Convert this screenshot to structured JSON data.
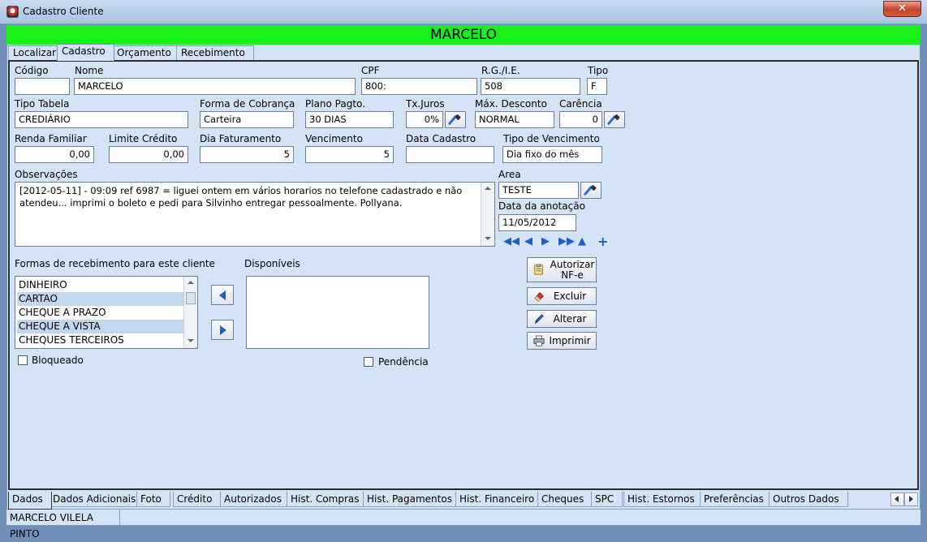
{
  "window": {
    "title": "Cadastro Cliente",
    "close_glyph": "✕"
  },
  "banner": {
    "name": "MARCELO"
  },
  "top_tabs": [
    {
      "label": "Localizar"
    },
    {
      "label": "Cadastro"
    },
    {
      "label": "Orçamento"
    },
    {
      "label": "Recebimento"
    }
  ],
  "form": {
    "codigo": {
      "label": "Código",
      "value": ""
    },
    "nome": {
      "label": "Nome",
      "value": "MARCELO"
    },
    "cpf": {
      "label": "CPF",
      "value": "800:"
    },
    "rg": {
      "label": "R.G./I.E.",
      "value": "508"
    },
    "tipo": {
      "label": "Tipo",
      "value": "F"
    },
    "tipo_tabela": {
      "label": "Tipo Tabela",
      "value": "CREDIÁRIO"
    },
    "forma_cobranca": {
      "label": "Forma de Cobrança",
      "value": "Carteira"
    },
    "plano_pagto": {
      "label": "Plano Pagto.",
      "value": "30 DIAS"
    },
    "tx_juros": {
      "label": "Tx.Juros",
      "value": "0%"
    },
    "max_desconto": {
      "label": "Máx. Desconto",
      "value": "NORMAL"
    },
    "carencia": {
      "label": "Carência",
      "value": "0"
    },
    "renda_familiar": {
      "label": "Renda Familiar",
      "value": "0,00"
    },
    "limite_credito": {
      "label": "Limite Crédito",
      "value": "0,00"
    },
    "dia_faturamento": {
      "label": "Dia Faturamento",
      "value": "5"
    },
    "vencimento": {
      "label": "Vencimento",
      "value": "5"
    },
    "data_cadastro": {
      "label": "Data Cadastro",
      "value": ""
    },
    "tipo_vencimento": {
      "label": "Tipo de Vencimento",
      "value": "Dia fixo do mês"
    },
    "observacoes": {
      "label": "Observações",
      "value": "[2012-05-11] - 09:09 ref 6987 = liguei ontem em vários horarios no telefone cadastrado e não atendeu... imprimi o boleto e pedi para Silvinho entregar pessoalmente. Pollyana."
    },
    "area": {
      "label": "Area",
      "value": "TESTE"
    },
    "data_anotacao": {
      "label": "Data da anotação",
      "value": "11/05/2012"
    }
  },
  "formas": {
    "label": "Formas de recebimento para este cliente",
    "items": [
      {
        "label": "DINHEIRO",
        "selected": false
      },
      {
        "label": "CARTAO",
        "selected": true
      },
      {
        "label": "CHEQUE A PRAZO",
        "selected": false
      },
      {
        "label": "CHEQUE A VISTA",
        "selected": true
      },
      {
        "label": "CHEQUES TERCEIROS",
        "selected": false
      }
    ]
  },
  "disponiveis": {
    "label": "Disponíveis",
    "items": []
  },
  "checkboxes": {
    "bloqueado": {
      "label": "Bloqueado",
      "checked": false
    },
    "pendencia": {
      "label": "Pendência",
      "checked": false
    }
  },
  "actions": {
    "autorizar_line1": "Autorizar",
    "autorizar_line2": "NF-e",
    "excluir": "Excluir",
    "alterar": "Alterar",
    "imprimir": "Imprimir"
  },
  "bottom_tabs": [
    {
      "label": "Dados"
    },
    {
      "label": "Dados Adicionais"
    },
    {
      "label": "Foto"
    },
    {
      "label": "Crédito"
    },
    {
      "label": "Autorizados"
    },
    {
      "label": "Hist. Compras"
    },
    {
      "label": "Hist. Pagamentos"
    },
    {
      "label": "Hist. Financeiro"
    },
    {
      "label": "Cheques"
    },
    {
      "label": "SPC"
    },
    {
      "label": "Hist. Estornos"
    },
    {
      "label": "Preferências"
    },
    {
      "label": "Outros Dados"
    }
  ],
  "status": {
    "client_full_name": "MARCELO VILELA PINTO"
  },
  "colors": {
    "banner": "#19f019",
    "panel": "#d4e3f5",
    "accent": "#1d5fc9"
  }
}
